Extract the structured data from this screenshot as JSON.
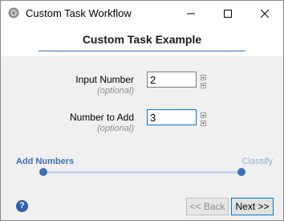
{
  "window": {
    "title": "Custom Task Workflow"
  },
  "header": {
    "title": "Custom Task Example"
  },
  "fields": [
    {
      "label": "Input Number",
      "sublabel": "(optional)",
      "value": "2"
    },
    {
      "label": "Number to Add",
      "sublabel": "(optional)",
      "value": "3"
    }
  ],
  "workflow": {
    "steps": [
      "Add Numbers",
      "Classify"
    ],
    "current_step": "Add Numbers"
  },
  "buttons": {
    "back": "<< Back",
    "next": "Next >>",
    "help": "?"
  },
  "colors": {
    "accent": "#3c6fb8",
    "focus": "#0078d7"
  }
}
